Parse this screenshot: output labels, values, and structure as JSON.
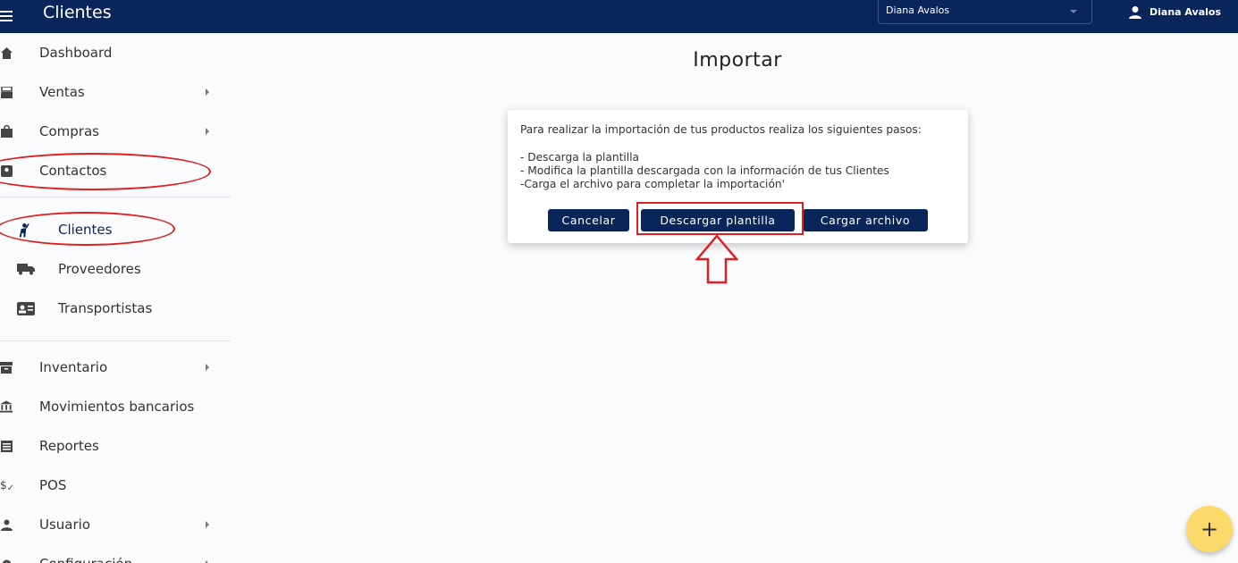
{
  "header": {
    "title": "Clientes",
    "user_select_value": "Diana Avalos",
    "account_name": "Diana Avalos"
  },
  "sidebar": {
    "items": [
      {
        "label": "Dashboard",
        "icon": "home-icon"
      },
      {
        "label": "Ventas",
        "icon": "register-icon",
        "expandable": true
      },
      {
        "label": "Compras",
        "icon": "bag-icon",
        "expandable": true
      },
      {
        "label": "Contactos",
        "icon": "contacts-icon"
      },
      {
        "label": "Clientes",
        "icon": "client-icon",
        "active": true
      },
      {
        "label": "Proveedores",
        "icon": "truck-icon"
      },
      {
        "label": "Transportistas",
        "icon": "id-card-icon"
      },
      {
        "label": "Inventario",
        "icon": "archive-icon",
        "expandable": true
      },
      {
        "label": "Movimientos bancarios",
        "icon": "bank-icon"
      },
      {
        "label": "Reportes",
        "icon": "report-icon"
      },
      {
        "label": "POS",
        "icon": "dollar-icon"
      },
      {
        "label": "Usuario",
        "icon": "user-icon",
        "expandable": true
      },
      {
        "label": "Configuración",
        "icon": "gear-icon",
        "expandable": true
      }
    ]
  },
  "main": {
    "title": "Importar",
    "dialog": {
      "intro": "Para realizar la importación de tus productos realiza los siguientes pasos:",
      "steps": [
        "- Descarga la plantilla",
        "- Modifica la plantilla descargada con la información de tus Clientes",
        "-Carga el archivo para completar la importación'"
      ],
      "buttons": {
        "cancel": "Cancelar",
        "download": "Descargar plantilla",
        "upload": "Cargar archivo"
      }
    },
    "fab_symbol": "+"
  },
  "colors": {
    "primary": "#0a2559",
    "annotation": "#e02020",
    "fab": "#fbd96b"
  }
}
